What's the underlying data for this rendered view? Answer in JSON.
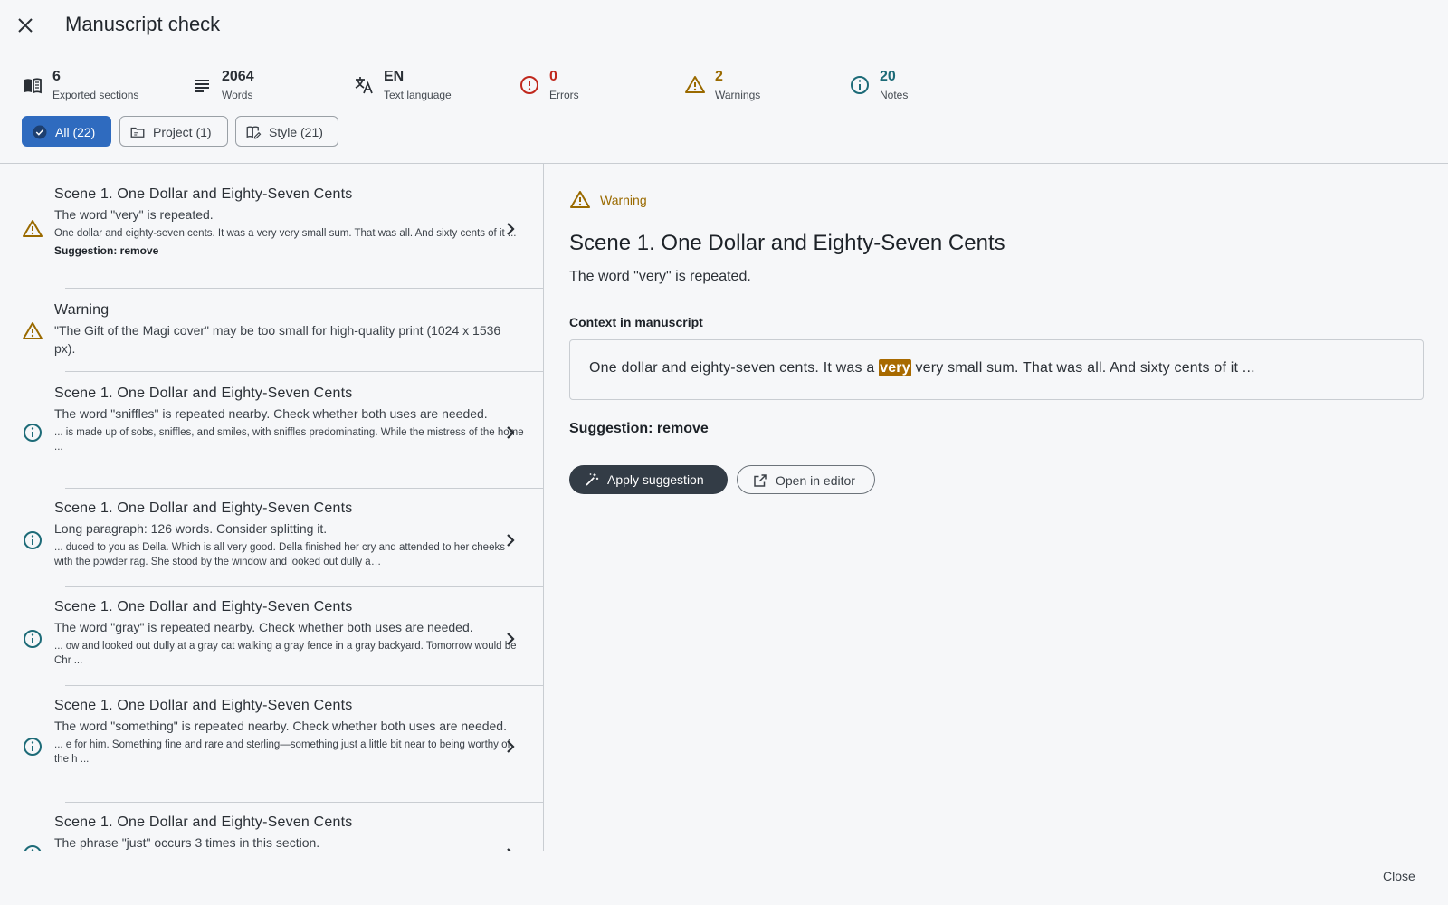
{
  "header": {
    "title": "Manuscript check",
    "close_icon": "close-icon"
  },
  "stats": [
    {
      "value": "6",
      "label": "Exported sections",
      "icon": "book-icon",
      "color": "#2a2f35"
    },
    {
      "value": "2064",
      "label": "Words",
      "icon": "lines-icon",
      "color": "#2a2f35"
    },
    {
      "value": "EN",
      "label": "Text language",
      "icon": "translate-icon",
      "color": "#2a2f35"
    },
    {
      "value": "0",
      "label": "Errors",
      "icon": "error-icon",
      "color": "#c0281d"
    },
    {
      "value": "2",
      "label": "Warnings",
      "icon": "warning-icon",
      "color": "#9a6a00"
    },
    {
      "value": "20",
      "label": "Notes",
      "icon": "info-icon",
      "color": "#1d6b78"
    }
  ],
  "filters": [
    {
      "label": "All (22)",
      "icon": "check-badge-icon",
      "active": true
    },
    {
      "label": "Project (1)",
      "icon": "folder-icon",
      "active": false
    },
    {
      "label": "Style (21)",
      "icon": "book-edit-icon",
      "active": false
    }
  ],
  "colors": {
    "warning": "#9a6a00",
    "note": "#1d6b78",
    "error": "#c0281d",
    "accent": "#2f6bbf"
  },
  "issues": [
    {
      "severity": "warning",
      "title": "Scene 1. One Dollar and Eighty-Seven Cents",
      "message": "The word \"very\" is repeated.",
      "context": "One dollar and eighty-seven cents. It was a very very small sum. That was all. And sixty cents of it ...",
      "suggestion": "Suggestion: remove",
      "chevron": true
    },
    {
      "severity": "warning",
      "title": "Warning",
      "message": "\"The Gift of the Magi cover\" may be too small for high-quality print (1024 x 1536 px).",
      "context": "",
      "suggestion": "",
      "chevron": false
    },
    {
      "severity": "note",
      "title": "Scene 1. One Dollar and Eighty-Seven Cents",
      "message": "The word \"sniffles\" is repeated nearby. Check whether both uses are needed.",
      "context": "... is made up of sobs, sniffles, and smiles, with sniffles predominating. While the mistress of the home ...",
      "suggestion": "",
      "chevron": true
    },
    {
      "severity": "note",
      "title": "Scene 1. One Dollar and Eighty-Seven Cents",
      "message": "Long paragraph: 126 words. Consider splitting it.",
      "context": "... duced to you as Della. Which is all very good. Della finished her cry and attended to her cheeks with the powder rag. She stood by the window and looked out dully a…",
      "suggestion": "",
      "chevron": true
    },
    {
      "severity": "note",
      "title": "Scene 1. One Dollar and Eighty-Seven Cents",
      "message": "The word \"gray\" is repeated nearby. Check whether both uses are needed.",
      "context": "... ow and looked out dully at a gray cat walking a gray fence in a gray backyard. Tomorrow would be Chr ...",
      "suggestion": "",
      "chevron": true
    },
    {
      "severity": "note",
      "title": "Scene 1. One Dollar and Eighty-Seven Cents",
      "message": "The word \"something\" is repeated nearby. Check whether both uses are needed.",
      "context": "... e for him. Something fine and rare and sterling—something just a little bit near to being worthy of the h ...",
      "suggestion": "",
      "chevron": true
    },
    {
      "severity": "note",
      "title": "Scene 1. One Dollar and Eighty-Seven Cents",
      "message": "The phrase \"just\" occurs 3 times in this section.",
      "context": "",
      "suggestion": "",
      "chevron": true
    }
  ],
  "detail": {
    "severity_label": "Warning",
    "title": "Scene 1. One Dollar and Eighty-Seven Cents",
    "message": "The word \"very\" is repeated.",
    "context_heading": "Context in manuscript",
    "context_before": "One dollar and eighty-seven cents. It was a ",
    "context_highlight": "very",
    "context_after": " very small sum. That was all. And sixty cents of it ...",
    "suggestion": "Suggestion: remove",
    "apply_label": "Apply suggestion",
    "open_label": "Open in editor"
  },
  "footer": {
    "close_label": "Close"
  }
}
